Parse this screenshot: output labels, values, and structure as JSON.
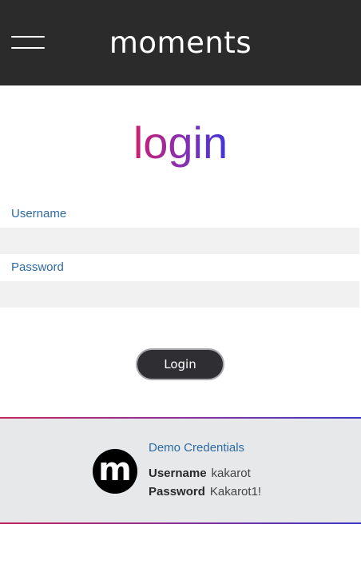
{
  "header": {
    "brand": "moments",
    "menu_icon": "hamburger-menu-icon"
  },
  "form": {
    "title": "login",
    "username_label": "Username",
    "username_value": "",
    "password_label": "Password",
    "password_value": "",
    "submit_label": "Login"
  },
  "demo": {
    "logo_letter": "m",
    "heading": "Demo Credentials",
    "username_key": "Username",
    "username_value": "kakarot",
    "password_key": "Password",
    "password_value": "Kakarot1!"
  },
  "colors": {
    "header_bg": "#2b2b2b",
    "label_blue": "#2f6aa3",
    "gradient_start": "#cf1e6e",
    "gradient_end": "#3f36d6",
    "panel_bg": "#e7e8ea"
  }
}
